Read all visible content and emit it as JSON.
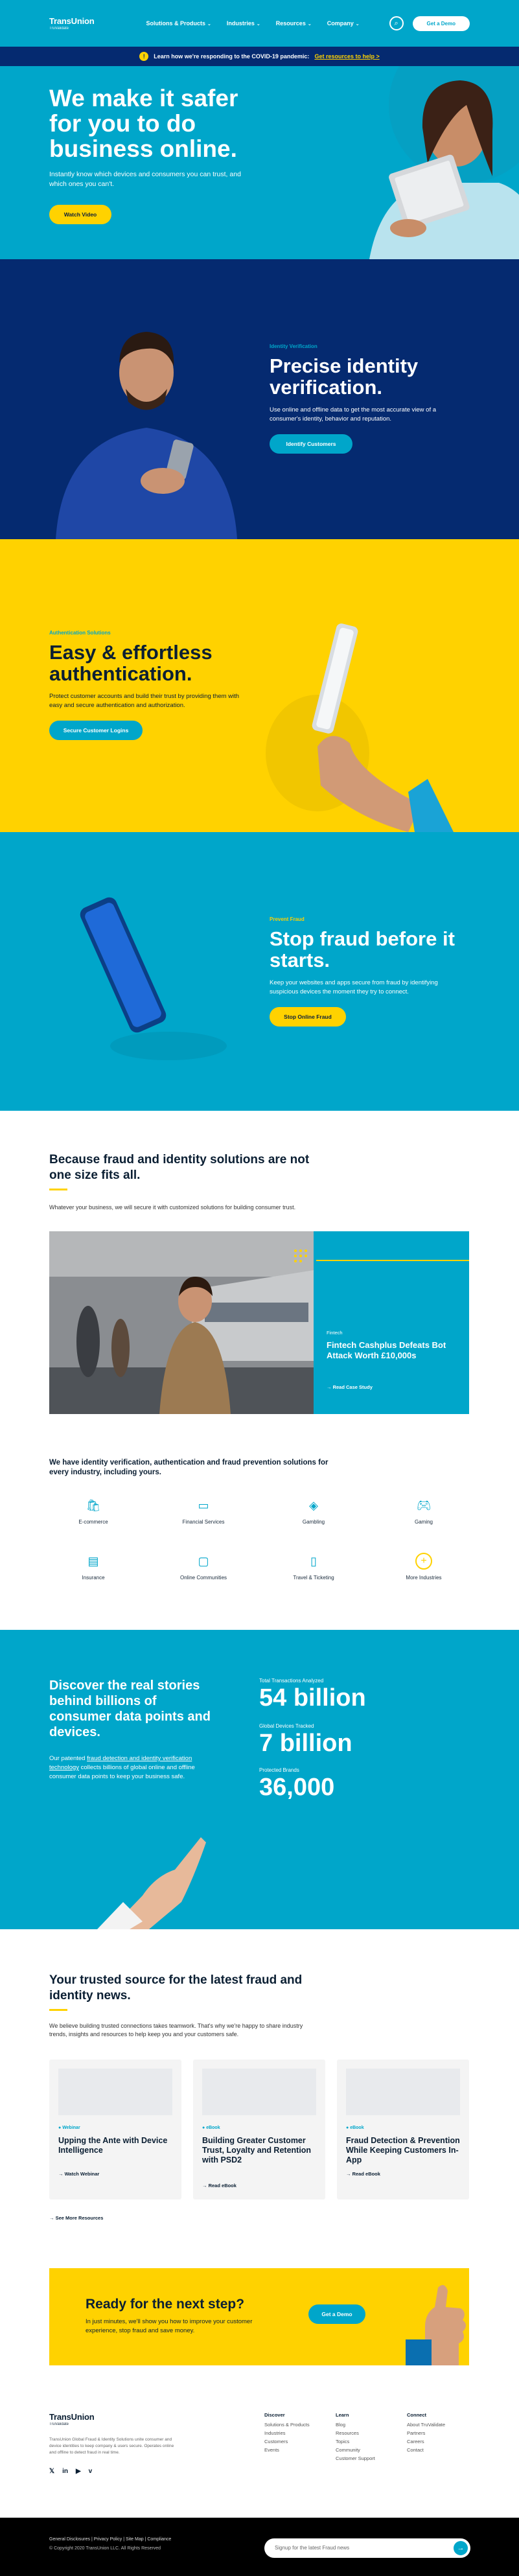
{
  "header": {
    "logo_main": "TransUnion",
    "logo_sub": "TruValidate",
    "nav": [
      "Solutions & Products",
      "Industries",
      "Resources",
      "Company"
    ],
    "demo_label": "Get a Demo"
  },
  "covid": {
    "text": "Learn how we're responding to the COVID-19 pandemic:",
    "link": "Get resources to help >"
  },
  "hero": {
    "title": "We make it safer for you to do business online.",
    "desc": "Instantly know which devices and consumers you can trust, and which ones you can't.",
    "button": "Watch Video"
  },
  "identity": {
    "eyebrow": "Identity Verification",
    "title": "Precise identity verification.",
    "desc": "Use online and offline data to get the most accurate view of a consumer's identity, behavior and reputation.",
    "button": "Identify Customers"
  },
  "auth": {
    "eyebrow": "Authentication Solutions",
    "title": "Easy & effortless authentication.",
    "desc": "Protect customer accounts and build their trust by providing them with easy and secure authentication and authorization.",
    "button": "Secure Customer Logins"
  },
  "fraud": {
    "eyebrow": "Prevent Fraud",
    "title": "Stop fraud before it starts.",
    "desc": "Keep your websites and apps secure from fraud by identifying suspicious devices the moment they try to connect.",
    "button": "Stop Online Fraud"
  },
  "fits": {
    "title": "Because fraud and identity solutions are not one size fits all.",
    "desc": "Whatever your business, we will secure it with customized solutions for building consumer trust.",
    "case_tag": "Fintech",
    "case_title": "Fintech Cashplus Defeats Bot Attack Worth £10,000s",
    "case_link": "Read Case Study"
  },
  "industries": {
    "title": "We have identity verification, authentication and fraud prevention solutions for every industry, including yours.",
    "items": [
      {
        "label": "E-commerce",
        "icon": "bag-icon"
      },
      {
        "label": "Financial Services",
        "icon": "card-icon"
      },
      {
        "label": "Gambling",
        "icon": "chips-icon"
      },
      {
        "label": "Gaming",
        "icon": "gamepad-icon"
      },
      {
        "label": "Insurance",
        "icon": "document-icon"
      },
      {
        "label": "Online Communities",
        "icon": "chat-icon"
      },
      {
        "label": "Travel & Ticketing",
        "icon": "luggage-icon"
      },
      {
        "label": "More Industries",
        "icon": "plus-icon"
      }
    ]
  },
  "stats": {
    "title": "Discover the real stories behind billions of consumer data points and devices.",
    "desc_pre": "Our patented",
    "desc_link": "fraud detection and identity verification technology",
    "desc_post": "collects billions of global online and offline consumer data points to keep your business safe.",
    "items": [
      {
        "label": "Total Transactions Analyzed",
        "value": "54 billion"
      },
      {
        "label": "Global Devices Tracked",
        "value": "7 billion"
      },
      {
        "label": "Protected Brands",
        "value": "36,000"
      }
    ]
  },
  "news": {
    "title": "Your trusted source for the latest fraud and identity news.",
    "desc": "We believe building trusted connections takes teamwork. That's why we're happy to share industry trends, insights and resources to help keep you and your customers safe.",
    "cards": [
      {
        "tag": "Webinar",
        "title": "Upping the Ante with Device Intelligence",
        "link": "Watch Webinar"
      },
      {
        "tag": "eBook",
        "title": "Building Greater Customer Trust, Loyalty and Retention with PSD2",
        "link": "Read eBook"
      },
      {
        "tag": "eBook",
        "title": "Fraud Detection & Prevention While Keeping Customers In-App",
        "link": "Read eBook"
      }
    ],
    "more": "See More Resources"
  },
  "cta": {
    "title": "Ready for the next step?",
    "desc": "In just minutes, we'll show you how to improve your customer experience, stop fraud and save money.",
    "button": "Get a Demo"
  },
  "footer": {
    "logo_main": "TransUnion",
    "logo_sub": "TruValidate",
    "about": "TransUnion Global Fraud & Identity Solutions unite consumer and device identities to keep company & users secure. Operates online and offline to detect fraud in real time.",
    "cols": [
      {
        "head": "Discover",
        "items": [
          "Solutions & Products",
          "Industries",
          "Customers",
          "Events"
        ]
      },
      {
        "head": "Learn",
        "items": [
          "Blog",
          "Resources",
          "Topics",
          "Community",
          "Customer Support"
        ]
      },
      {
        "head": "Connect",
        "items": [
          "About TruValidate",
          "Partners",
          "Careers",
          "Contact"
        ]
      }
    ],
    "social": [
      "twitter-icon",
      "linkedin-icon",
      "youtube-icon",
      "vimeo-icon"
    ],
    "legal_links": "General Disclosures  |  Privacy Policy  |  Site Map  |  Compliance",
    "copyright": "© Copyright 2020 TransUnion LLC. All Rights Reserved",
    "subscribe_placeholder": "Signup for the latest Fraud news"
  }
}
